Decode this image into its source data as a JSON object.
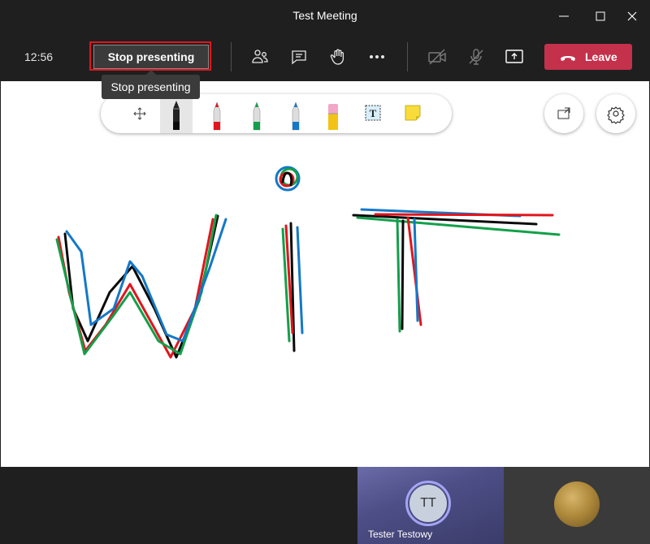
{
  "window": {
    "title": "Test Meeting"
  },
  "toolbar": {
    "clock": "12:56",
    "stop_presenting_label": "Stop presenting",
    "leave_label": "Leave",
    "accent_leave": "#c4314b",
    "highlight_outline": "#e0151d"
  },
  "tooltip": {
    "text": "Stop presenting"
  },
  "ink_tools": [
    {
      "name": "move-icon"
    },
    {
      "name": "black-pen-icon",
      "selected": true
    },
    {
      "name": "red-pen-icon"
    },
    {
      "name": "green-pen-icon"
    },
    {
      "name": "blue-pen-icon"
    },
    {
      "name": "eraser-icon"
    },
    {
      "name": "text-box-icon"
    },
    {
      "name": "sticky-note-icon"
    }
  ],
  "whiteboard": {
    "handwritten_text": "WiT"
  },
  "participants": [
    {
      "initials": "TT",
      "name": "Tester Testowy"
    },
    {
      "avatar": "moon-avatar"
    }
  ]
}
